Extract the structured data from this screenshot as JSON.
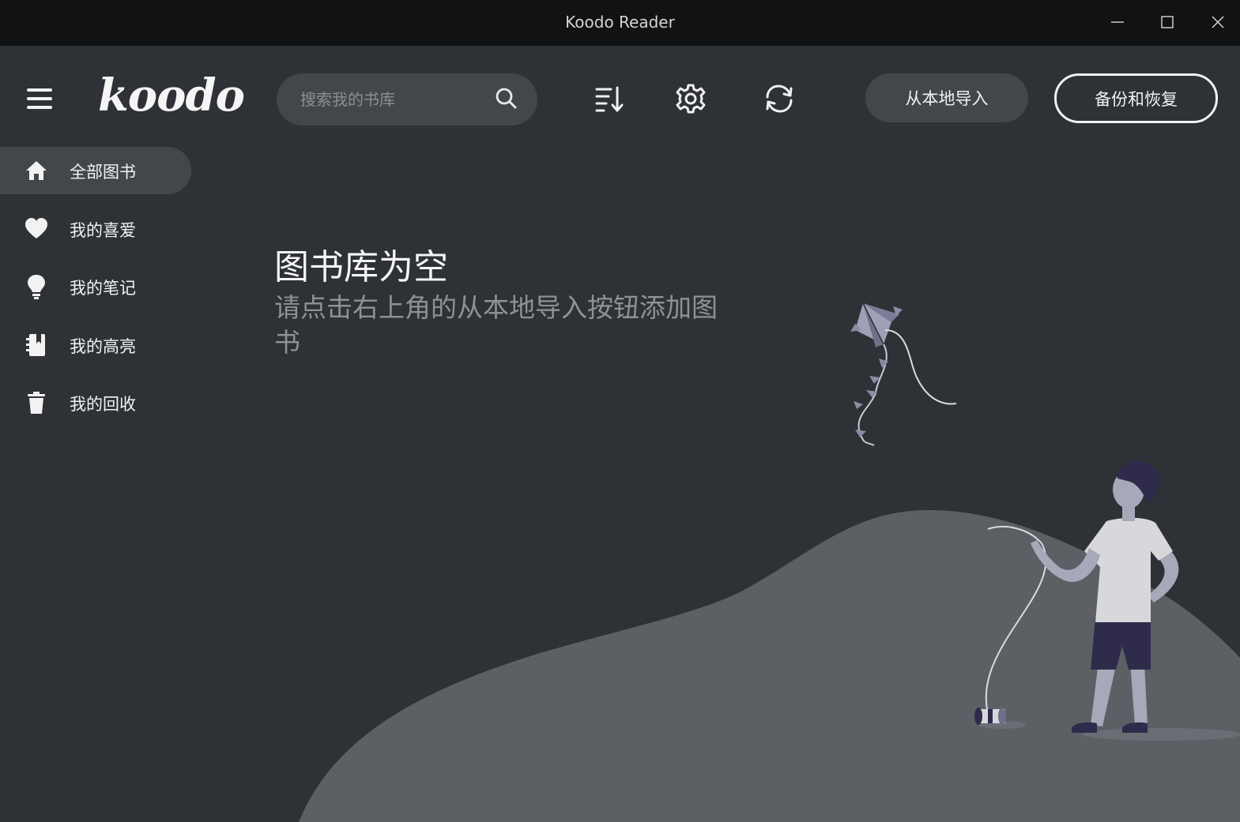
{
  "window": {
    "title": "Koodo Reader",
    "minimize_icon": "minimize-icon",
    "maximize_icon": "maximize-icon",
    "close_icon": "close-icon"
  },
  "header": {
    "logo_text": "koodo",
    "search": {
      "placeholder": "搜索我的书库",
      "value": ""
    },
    "import_label": "从本地导入",
    "backup_label": "备份和恢复"
  },
  "sidebar": {
    "items": [
      {
        "label": "全部图书",
        "icon": "home-icon",
        "active": true
      },
      {
        "label": "我的喜爱",
        "icon": "heart-icon",
        "active": false
      },
      {
        "label": "我的笔记",
        "icon": "lightbulb-icon",
        "active": false
      },
      {
        "label": "我的高亮",
        "icon": "notebook-icon",
        "active": false
      },
      {
        "label": "我的回收",
        "icon": "trash-icon",
        "active": false
      }
    ]
  },
  "main": {
    "empty_title": "图书库为空",
    "empty_subtitle": "请点击右上角的从本地导入按钮添加图书"
  },
  "colors": {
    "background": "#2e3135",
    "titlebar": "#111213",
    "surface": "#43474b",
    "text": "#f2f2f2",
    "muted": "#8e9195",
    "hill": "#5c6064"
  }
}
